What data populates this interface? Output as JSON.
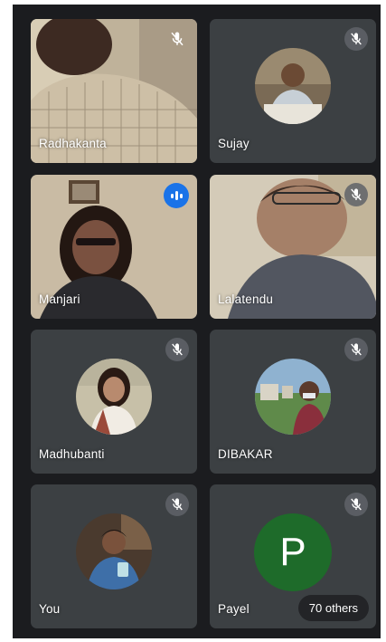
{
  "participants": [
    {
      "name": "Radhakanta",
      "muted": true
    },
    {
      "name": "Sujay",
      "muted": true
    },
    {
      "name": "Manjari",
      "speaking": true
    },
    {
      "name": "Lalatendu",
      "muted": true
    },
    {
      "name": "Madhubanti",
      "muted": true
    },
    {
      "name": "DIBAKAR",
      "muted": true
    },
    {
      "name": "You",
      "muted": true
    },
    {
      "name": "Payel",
      "muted": true,
      "avatar_letter": "P"
    }
  ],
  "overflow": {
    "label": "70 others"
  },
  "colors": {
    "background": "#1b1c1f",
    "tile": "#3c4043",
    "speaking": "#1a73e8",
    "avatar_green": "#1e6b2a"
  }
}
